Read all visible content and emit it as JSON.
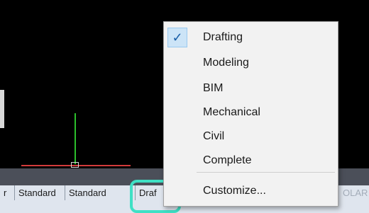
{
  "menu": {
    "items": [
      {
        "label": "Drafting",
        "checked": true
      },
      {
        "label": "Modeling",
        "checked": false
      },
      {
        "label": "BIM",
        "checked": false
      },
      {
        "label": "Mechanical",
        "checked": false
      },
      {
        "label": "Civil",
        "checked": false
      },
      {
        "label": "Complete",
        "checked": false
      }
    ],
    "customize_label": "Customize...",
    "check_glyph": "✓"
  },
  "statusbar": {
    "item0": "r",
    "item1": "Standard",
    "item2": "Standard",
    "item3": "Draf",
    "item4": "OLAR"
  },
  "colors": {
    "canvas": "#000000",
    "highlight": "#3fe0c5",
    "ucs_y_axis": "#2bbf2b",
    "ucs_x_axis": "#d33b3b",
    "check_bg": "#cce4f7"
  }
}
